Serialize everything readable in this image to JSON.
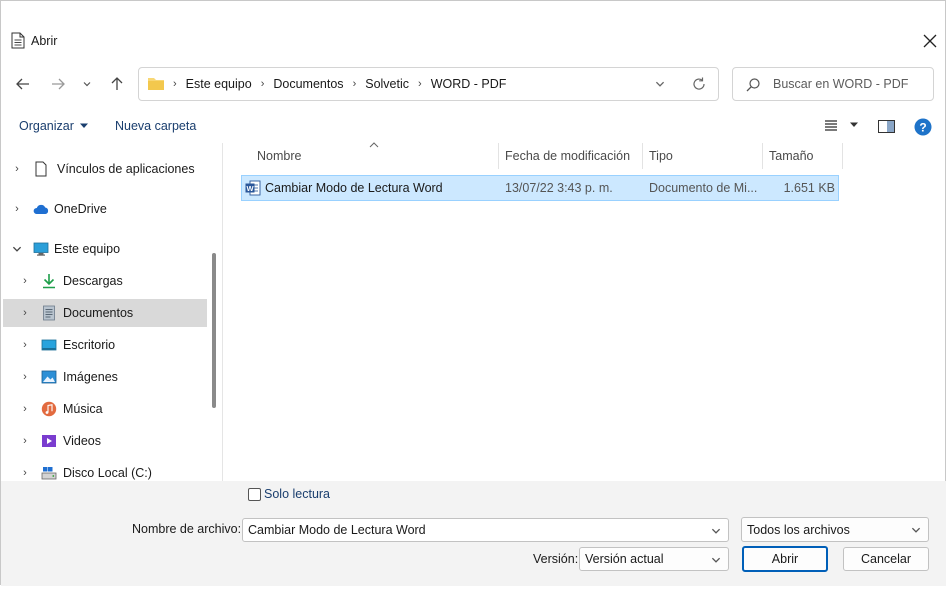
{
  "window": {
    "title": "Abrir"
  },
  "address": {
    "crumbs": [
      "Este equipo",
      "Documentos",
      "Solvetic",
      "WORD - PDF"
    ]
  },
  "search": {
    "placeholder": "Buscar en WORD - PDF"
  },
  "toolbar": {
    "organize": "Organizar",
    "new_folder": "Nueva carpeta"
  },
  "nav": {
    "items": [
      {
        "label": "Vínculos de aplicaciones",
        "icon": "document-icon"
      },
      {
        "label": "OneDrive",
        "icon": "cloud-icon"
      },
      {
        "label": "Este equipo",
        "icon": "monitor-icon"
      },
      {
        "label": "Descargas",
        "icon": "download-icon"
      },
      {
        "label": "Documentos",
        "icon": "documents-icon"
      },
      {
        "label": "Escritorio",
        "icon": "desktop-icon"
      },
      {
        "label": "Imágenes",
        "icon": "pictures-icon"
      },
      {
        "label": "Música",
        "icon": "music-icon"
      },
      {
        "label": "Videos",
        "icon": "videos-icon"
      },
      {
        "label": "Disco Local (C:)",
        "icon": "drive-icon"
      }
    ]
  },
  "columns": {
    "name": "Nombre",
    "modified": "Fecha de modificación",
    "type": "Tipo",
    "size": "Tamaño"
  },
  "files": [
    {
      "name": "Cambiar Modo de Lectura Word",
      "modified": "13/07/22 3:43 p. m.",
      "type": "Documento de Mi...",
      "size": "1.651 KB"
    }
  ],
  "footer": {
    "read_only": "Solo lectura",
    "filename_label": "Nombre de archivo:",
    "filename_value": "Cambiar Modo de Lectura Word",
    "filter_value": "Todos los archivos",
    "version_label": "Versión:",
    "version_value": "Versión actual",
    "open": "Abrir",
    "cancel": "Cancelar"
  },
  "colors": {
    "accent": "#005fb8",
    "selection": "#cce8ff"
  }
}
